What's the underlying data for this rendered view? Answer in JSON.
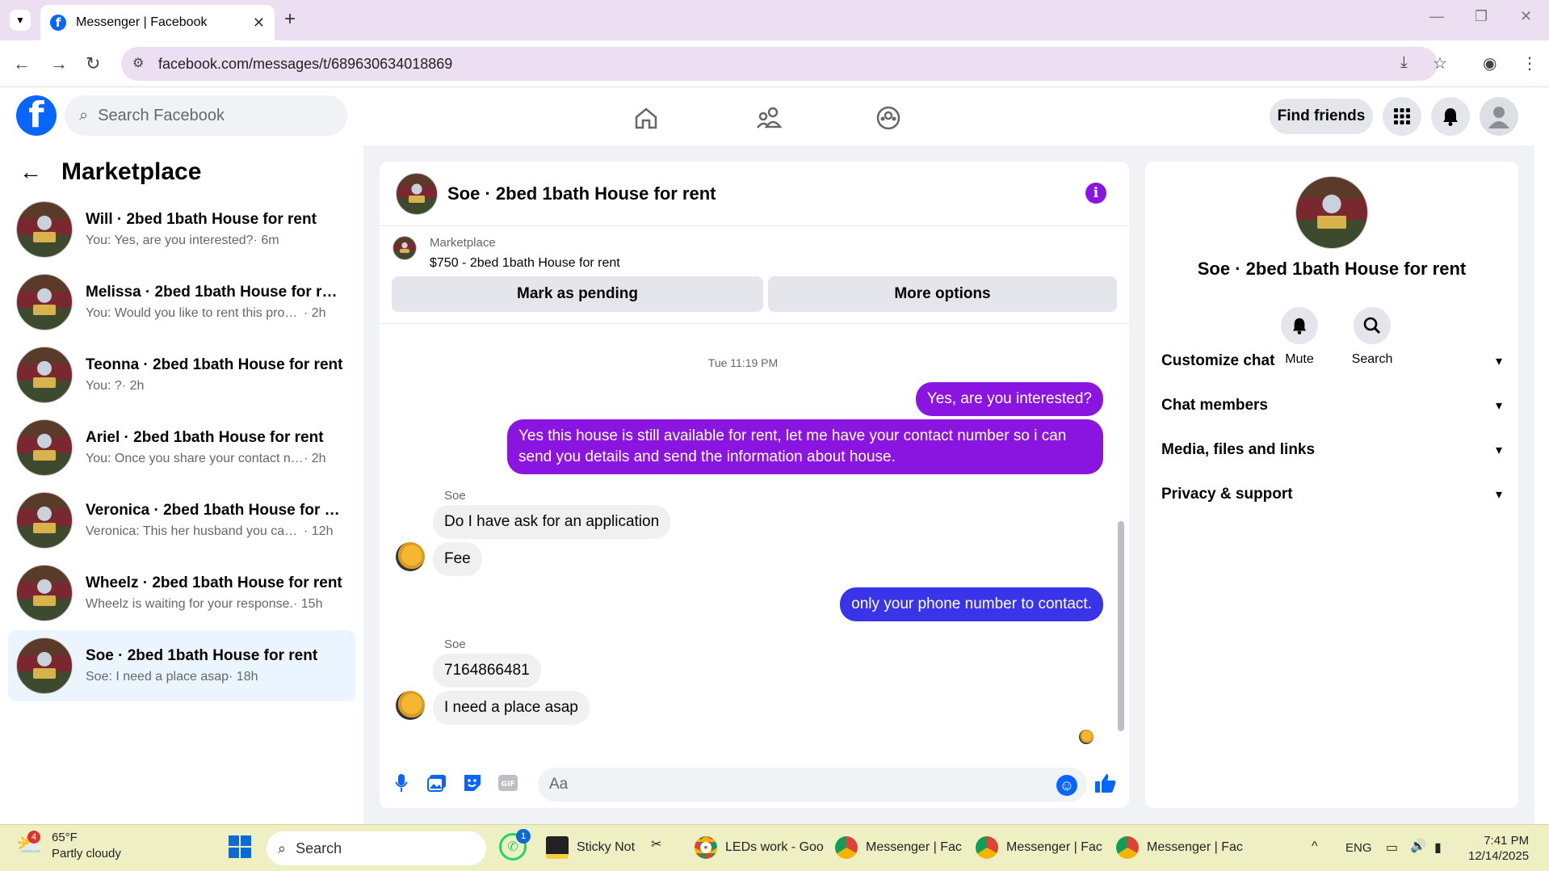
{
  "browser": {
    "tab_title": "Messenger | Facebook",
    "url": "facebook.com/messages/t/689630634018869"
  },
  "fb": {
    "search_placeholder": "Search Facebook",
    "find_friends": "Find friends"
  },
  "sidebar": {
    "title": "Marketplace",
    "conversations": [
      {
        "name": "Will · 2bed 1bath House for rent",
        "preview": "You: Yes, are you interested?",
        "time": "· 6m"
      },
      {
        "name": "Melissa · 2bed 1bath House for rent",
        "preview": "You: Would you like to rent this prope...",
        "time": "· 2h"
      },
      {
        "name": "Teonna · 2bed 1bath House for rent",
        "preview": "You: ?",
        "time": "· 2h"
      },
      {
        "name": "Ariel · 2bed 1bath House for rent",
        "preview": "You: Once you share your contact nu...",
        "time": "· 2h"
      },
      {
        "name": "Veronica · 2bed 1bath House for re...",
        "preview": "Veronica: This her husband you can ...",
        "time": "· 12h"
      },
      {
        "name": "Wheelz · 2bed 1bath House for rent",
        "preview": "Wheelz is waiting for your response.",
        "time": "· 15h"
      },
      {
        "name": "Soe · 2bed 1bath House for rent",
        "preview": "Soe: I need a place asap",
        "time": "· 18h"
      }
    ]
  },
  "chat": {
    "title": "Soe · 2bed 1bath House for rent",
    "marketplace_label": "Marketplace",
    "listing": "$750 - 2bed 1bath House for rent",
    "mark_pending": "Mark as pending",
    "more_options": "More options",
    "timestamp": "Tue 11:19 PM",
    "messages": {
      "m1": "Yes, are you interested?",
      "m2": "Yes this house is still available for rent, let me have your contact number so i can send you details and send the information about house.",
      "sender1": "Soe",
      "m3": "Do I have ask for an application",
      "m4": "Fee",
      "m5": "only your phone number to contact.",
      "sender2": "Soe",
      "m6": "7164866481",
      "m7": "I need a place asap"
    },
    "composer_placeholder": "Aa"
  },
  "rpanel": {
    "name": "Soe · 2bed 1bath House for rent",
    "mute": "Mute",
    "search": "Search",
    "sections": [
      "Customize chat",
      "Chat members",
      "Media, files and links",
      "Privacy & support"
    ]
  },
  "taskbar": {
    "temp": "65°F",
    "weather": "Partly cloudy",
    "weather_badge": "4",
    "search": "Search",
    "whatsapp_badge": "1",
    "apps": [
      "Sticky Not",
      "LEDs work - Goo",
      "Messenger | Fac",
      "Messenger | Fac",
      "Messenger | Fac"
    ],
    "lang": "ENG",
    "time": "7:41 PM",
    "date": "12/14/2025"
  },
  "colors": {
    "accent": "#0866ff",
    "outgoing": "#8a14e0",
    "outgoing_alt": "#3a34e8"
  }
}
